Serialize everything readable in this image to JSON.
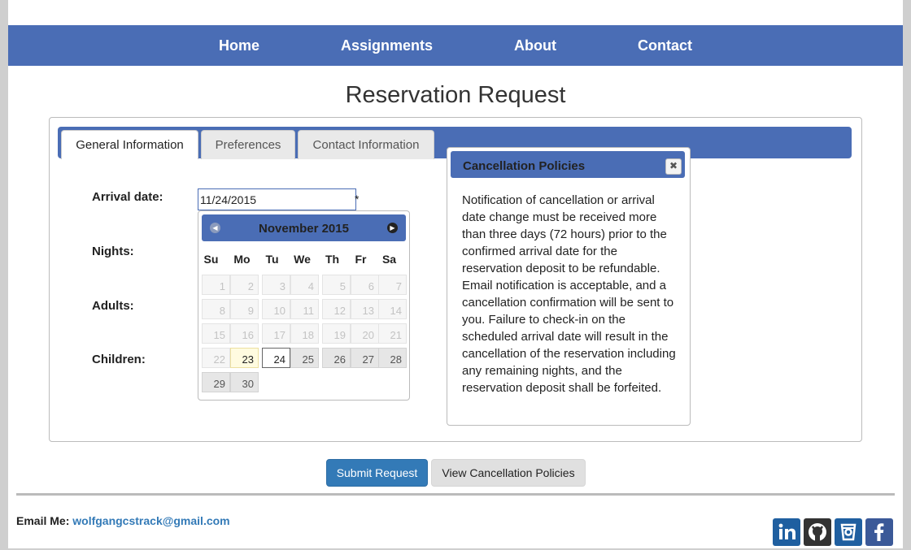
{
  "nav": {
    "items": [
      "Home",
      "Assignments",
      "About",
      "Contact"
    ]
  },
  "page_title": "Reservation Request",
  "tabs": [
    "General Information",
    "Preferences",
    "Contact Information"
  ],
  "form": {
    "arrival_label": "Arrival date:",
    "arrival_value": "11/24/2015",
    "required_mark": "*",
    "nights_label": "Nights:",
    "adults_label": "Adults:",
    "children_label": "Children:"
  },
  "datepicker": {
    "month_title": "November 2015",
    "prev_icon": "prev-circle-icon",
    "next_icon": "next-circle-icon",
    "weekdays": [
      "Su",
      "Mo",
      "Tu",
      "We",
      "Th",
      "Fr",
      "Sa"
    ],
    "weeks": [
      [
        "1",
        "2",
        "3",
        "4",
        "5",
        "6",
        "7"
      ],
      [
        "8",
        "9",
        "10",
        "11",
        "12",
        "13",
        "14"
      ],
      [
        "15",
        "16",
        "17",
        "18",
        "19",
        "20",
        "21"
      ],
      [
        "22",
        "23",
        "24",
        "25",
        "26",
        "27",
        "28"
      ],
      [
        "29",
        "30"
      ]
    ],
    "today": "23",
    "selected": "24"
  },
  "dialog": {
    "title": "Cancellation Policies",
    "close_icon": "close-icon",
    "body": "Notification of cancellation or arrival date change must be received more than three days (72 hours) prior to the confirmed arrival date for the reservation deposit to be refundable. Email notification is acceptable, and a cancellation confirmation will be sent to you. Failure to check-in on the scheduled arrival date will result in the cancellation of the reservation including any remaining nights, and the reservation deposit shall be forfeited."
  },
  "buttons": {
    "submit": "Submit Request",
    "view_policies": "View Cancellation Policies"
  },
  "footer": {
    "email_label": "Email Me:",
    "email": "wolfgangcstrack@gmail.com",
    "social_icons": [
      "linkedin-icon",
      "github-icon",
      "codeeval-icon",
      "facebook-icon"
    ]
  },
  "colors": {
    "nav_bg": "#4a6db5",
    "primary_button": "#337ab7",
    "link": "#337ab7"
  }
}
